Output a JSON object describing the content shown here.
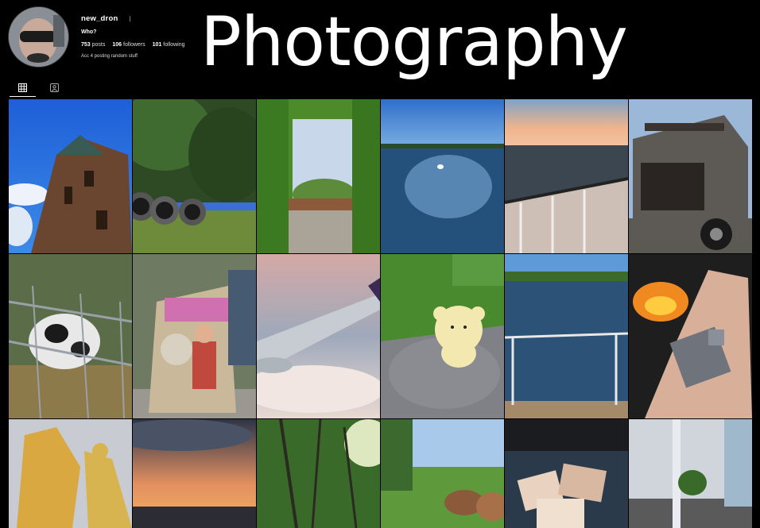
{
  "profile": {
    "username": "new_dron",
    "more_icon": "separator",
    "name": "Who?",
    "stats": {
      "posts_count": "753",
      "posts_label": "posts",
      "followers_count": "106",
      "followers_label": "followers",
      "following_count": "101",
      "following_label": "following"
    },
    "bio": "Acc 4 posting random stuff"
  },
  "overlay_title": "Photography",
  "tabs": [
    {
      "icon": "grid-icon",
      "active": true
    },
    {
      "icon": "tagged-icon",
      "active": false
    }
  ],
  "colors": {
    "background": "#000000",
    "text": "#ffffff",
    "muted": "#aaaaaa"
  }
}
